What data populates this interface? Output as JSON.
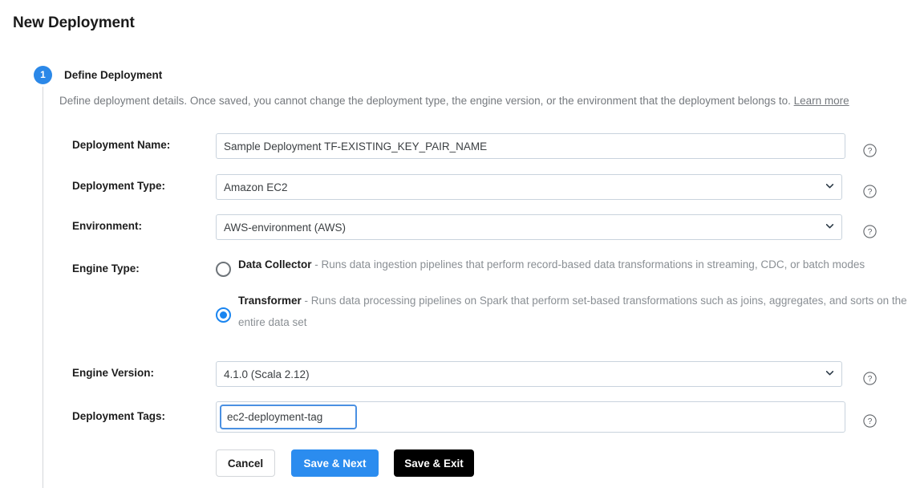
{
  "page": {
    "title": "New Deployment"
  },
  "step": {
    "number": "1",
    "title": "Define Deployment",
    "description": "Define deployment details. Once saved, you cannot change the deployment type, the engine version, or the environment that the deployment belongs to.",
    "learn_more": "Learn more"
  },
  "form": {
    "deployment_name": {
      "label": "Deployment Name:",
      "value": "Sample Deployment TF-EXISTING_KEY_PAIR_NAME",
      "placeholder": ""
    },
    "deployment_type": {
      "label": "Deployment Type:",
      "value": "Amazon EC2",
      "options": [
        "Amazon EC2"
      ]
    },
    "environment": {
      "label": "Environment:",
      "value": "AWS-environment (AWS)",
      "options": [
        "AWS-environment (AWS)"
      ]
    },
    "engine_type": {
      "label": "Engine Type:",
      "options": [
        {
          "name": "Data Collector",
          "description": " - Runs data ingestion pipelines that perform record-based data transformations in streaming, CDC, or batch modes",
          "selected": false
        },
        {
          "name": "Transformer",
          "description": " - Runs data processing pipelines on Spark that perform set-based transformations such as joins, aggregates, and sorts on the entire data set",
          "selected": true
        }
      ]
    },
    "engine_version": {
      "label": "Engine Version:",
      "value": "4.1.0 (Scala 2.12)",
      "options": [
        "4.1.0 (Scala 2.12)"
      ]
    },
    "deployment_tags": {
      "label": "Deployment Tags:",
      "value": "ec2-deployment-tag",
      "placeholder": ""
    }
  },
  "buttons": {
    "cancel": "Cancel",
    "save_next": "Save & Next",
    "save_exit": "Save & Exit"
  },
  "icons": {
    "help": "help-circle-icon",
    "chevron": "chevron-down-icon"
  },
  "colors": {
    "accent": "#2b8cef",
    "step_badge": "#2b88e8",
    "radio_selected": "#1a85f0",
    "dark_button": "#000000",
    "muted_text": "#75797e"
  }
}
